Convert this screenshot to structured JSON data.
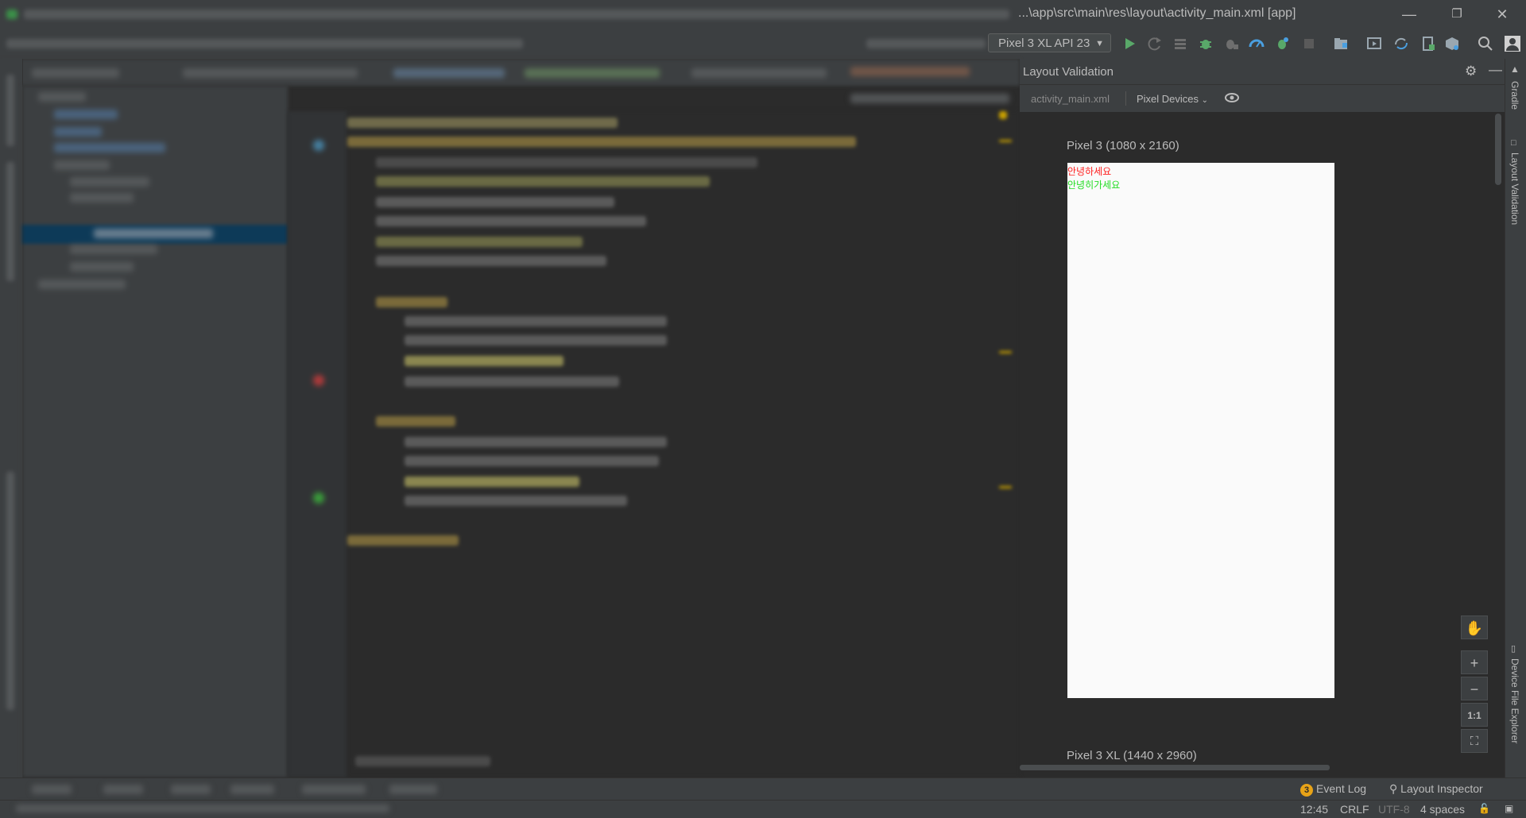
{
  "window": {
    "path": "...\\app\\src\\main\\res\\layout\\activity_main.xml [app]",
    "minimize_icon": "minimize-icon",
    "restore_icon": "restore-icon",
    "close_icon": "close-icon"
  },
  "toolbar": {
    "device": "Pixel 3 XL API 23",
    "icons": [
      "run-icon",
      "rerun-icon",
      "coverage-icon",
      "debug-icon",
      "attach-debugger-icon",
      "profile-icon",
      "apply-changes-icon",
      "stop-icon",
      "project-structure-icon",
      "avd-manager-icon",
      "sync-icon",
      "sdk-manager-icon",
      "search-icon",
      "user-icon"
    ]
  },
  "layout_validation": {
    "title": "Layout Validation",
    "file": "activity_main.xml",
    "device_set": "Pixel Devices",
    "devices": [
      {
        "label": "Pixel 3 (1080 x 2160)"
      },
      {
        "label": "Pixel 3 XL (1440 x 2960)"
      }
    ],
    "preview_texts": [
      {
        "text": "안녕하세요",
        "color": "#ff2020"
      },
      {
        "text": "안녕히가세요",
        "color": "#22dd22"
      }
    ],
    "zoom_controls": {
      "pan": "✋",
      "zoom_in": "+",
      "zoom_out": "−",
      "actual_size": "1:1",
      "fit": "⛶"
    }
  },
  "right_tools": {
    "gradle": "Gradle",
    "layout_validation": "Layout Validation",
    "device_file_explorer": "Device File Explorer"
  },
  "bottom_tools": {
    "event_log_count": "3",
    "event_log": "Event Log",
    "layout_inspector": "Layout Inspector"
  },
  "status": {
    "position": "12:45",
    "line_sep": "CRLF",
    "encoding": "UTF-8",
    "indent": "4 spaces"
  }
}
